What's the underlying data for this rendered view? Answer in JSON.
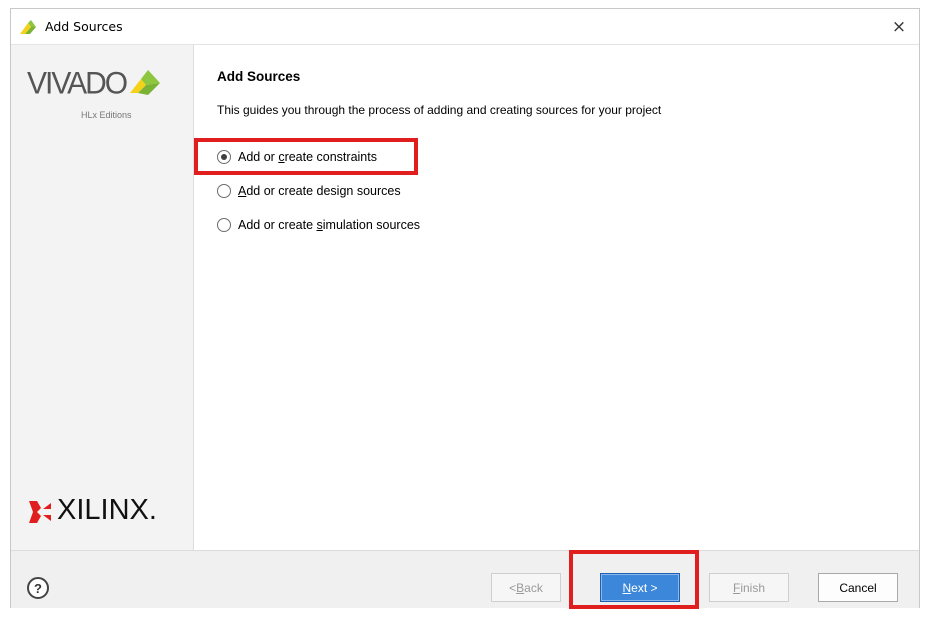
{
  "window": {
    "title": "Add Sources",
    "close_glyph": "×",
    "icon": "vivado-icon"
  },
  "sidebar": {
    "brand_top": "VIVADO",
    "brand_top_sub": "HLx Editions",
    "brand_bottom": "XILINX.",
    "brand_colors": {
      "arrow_green": "#8dc63f",
      "arrow_yellow": "#f5d21a",
      "xilinx_red": "#e01e1e"
    }
  },
  "main": {
    "title": "Add Sources",
    "description": "This guides you through the process of adding and creating sources for your project",
    "options": [
      {
        "pre": "Add or ",
        "mnemonic": "c",
        "post": "reate constraints",
        "checked": true
      },
      {
        "pre": "",
        "mnemonic": "A",
        "post": "dd or create design sources",
        "checked": false
      },
      {
        "pre": "Add or create ",
        "mnemonic": "s",
        "post": "imulation sources",
        "checked": false
      }
    ]
  },
  "footer": {
    "help_label": "?",
    "back_pre": "< ",
    "back_mnemonic": "B",
    "back_post": "ack",
    "next_mnemonic": "N",
    "next_post": "ext >",
    "finish_mnemonic": "F",
    "finish_post": "inish",
    "cancel_label": "Cancel"
  },
  "colors": {
    "highlight": "#e01e1e",
    "primary_button": "#3c87d9"
  }
}
